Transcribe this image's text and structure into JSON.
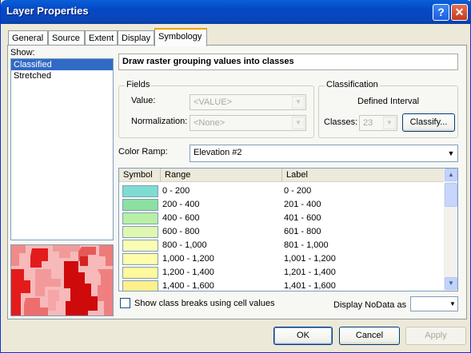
{
  "window": {
    "title": "Layer Properties",
    "help_label": "?",
    "close_label": "✕"
  },
  "tabs": [
    {
      "label": "General"
    },
    {
      "label": "Source"
    },
    {
      "label": "Extent"
    },
    {
      "label": "Display"
    },
    {
      "label": "Symbology"
    }
  ],
  "show": {
    "label": "Show:",
    "items": [
      "Classified",
      "Stretched"
    ],
    "selected": "Classified"
  },
  "heading": "Draw raster grouping values into classes",
  "fields": {
    "title": "Fields",
    "value_label": "Value:",
    "value_select": "<VALUE>",
    "normalization_label": "Normalization:",
    "normalization_select": "<None>"
  },
  "classification": {
    "title": "Classification",
    "method": "Defined Interval",
    "classes_label": "Classes:",
    "classes_value": "23",
    "classify_button": "Classify..."
  },
  "color_ramp": {
    "label": "Color Ramp:",
    "value": "Elevation #2"
  },
  "table": {
    "headers": [
      "Symbol",
      "Range",
      "Label"
    ],
    "rows": [
      {
        "color": "#7fdcd0",
        "range": "0 - 200",
        "label": "0 - 200"
      },
      {
        "color": "#8ce0a0",
        "range": "200 - 400",
        "label": "201 - 400"
      },
      {
        "color": "#b8efa4",
        "range": "400 - 600",
        "label": "401 - 600"
      },
      {
        "color": "#e0f7b0",
        "range": "600 - 800",
        "label": "601 - 800"
      },
      {
        "color": "#fbfcb4",
        "range": "800 - 1,000",
        "label": "801 - 1,000"
      },
      {
        "color": "#fffcaa",
        "range": "1,000 - 1,200",
        "label": "1,001 - 1,200"
      },
      {
        "color": "#fff89c",
        "range": "1,200 - 1,400",
        "label": "1,201 - 1,400"
      },
      {
        "color": "#fff08c",
        "range": "1,400 - 1,600",
        "label": "1,401 - 1,600"
      }
    ]
  },
  "checkbox_label": "Show class breaks using cell values",
  "nodata_label": "Display NoData as",
  "buttons": {
    "ok": "OK",
    "cancel": "Cancel",
    "apply": "Apply"
  }
}
